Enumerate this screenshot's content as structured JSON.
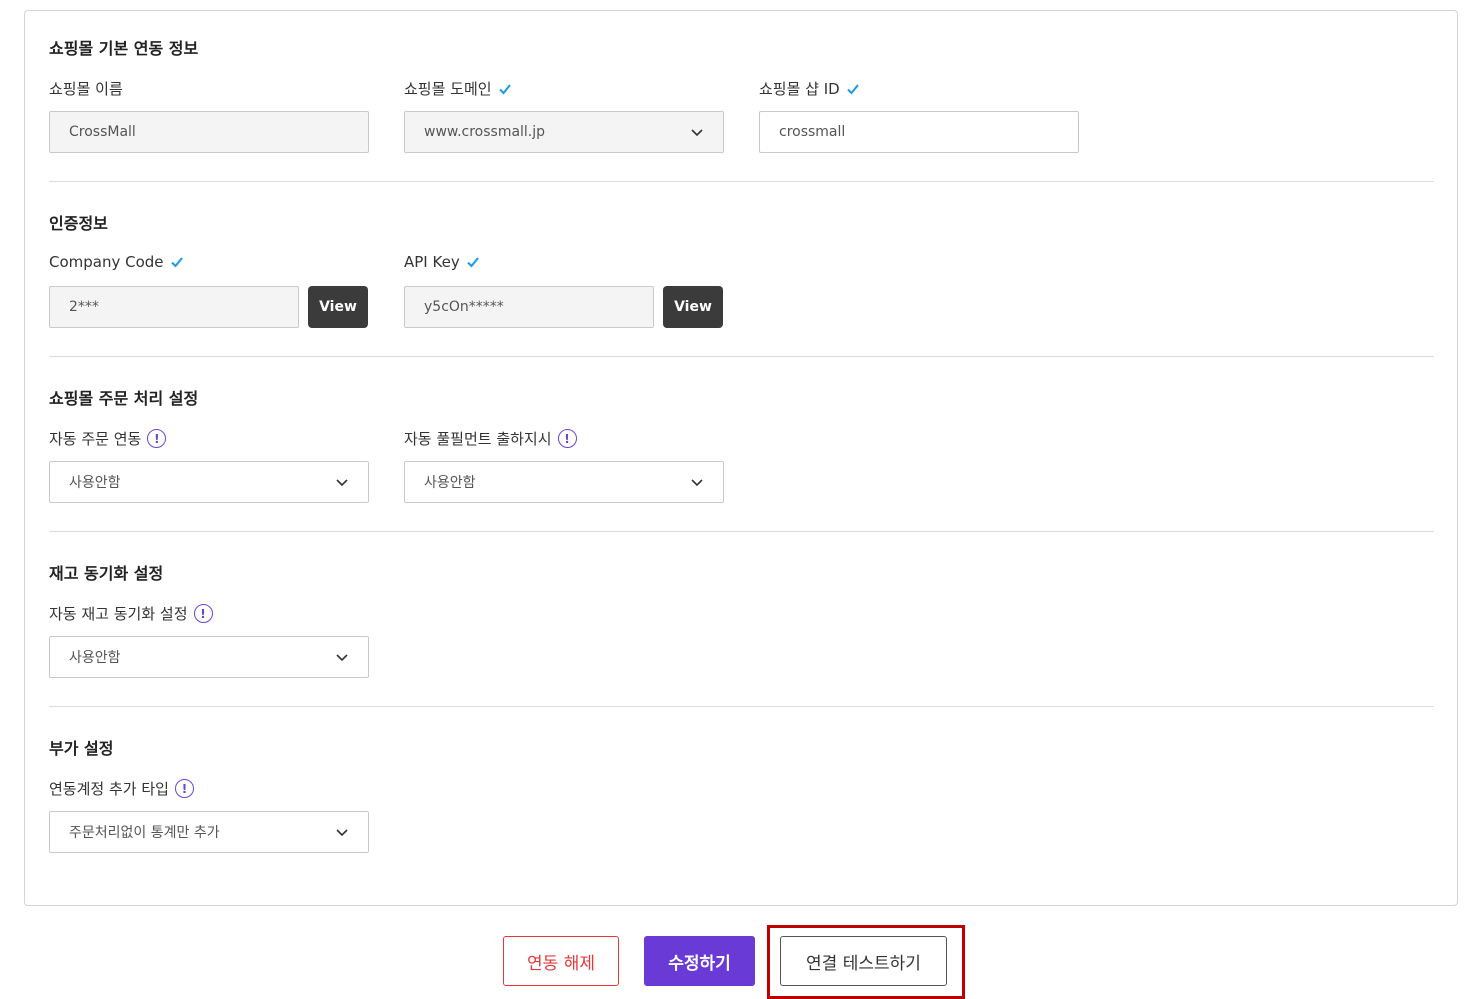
{
  "sections": {
    "basic": {
      "title": "쇼핑몰 기본 연동 정보",
      "mall_name_label": "쇼핑몰 이름",
      "mall_name_value": "CrossMall",
      "domain_label": "쇼핑몰 도메인",
      "domain_value": "www.crossmall.jp",
      "shop_id_label": "쇼핑몰 샵 ID",
      "shop_id_value": "crossmall"
    },
    "auth": {
      "title": "인증정보",
      "company_code_label": "Company Code",
      "company_code_value": "2***",
      "api_key_label": "API Key",
      "api_key_value": "y5cOn*****",
      "view_label": "View"
    },
    "order": {
      "title": "쇼핑몰 주문 처리 설정",
      "auto_order_label": "자동 주문 연동",
      "auto_order_value": "사용안함",
      "auto_fulfill_label": "자동 풀필먼트 출하지시",
      "auto_fulfill_value": "사용안함"
    },
    "stock": {
      "title": "재고 동기화 설정",
      "auto_stock_label": "자동 재고 동기화 설정",
      "auto_stock_value": "사용안함"
    },
    "extra": {
      "title": "부가 설정",
      "account_type_label": "연동계정 추가 타입",
      "account_type_value": "주문처리없이 통계만 추가"
    }
  },
  "buttons": {
    "unlink": "연동 해제",
    "edit": "수정하기",
    "test": "연결 테스트하기"
  },
  "icons": {
    "check": "check-icon",
    "info": "info-icon",
    "chevron": "chevron-down-icon",
    "info_glyph": "!"
  },
  "colors": {
    "check": "#1a9be8",
    "info": "#6a45d4",
    "primary": "#6a3ad6",
    "danger": "#e5383b",
    "highlight": "#c00000"
  }
}
